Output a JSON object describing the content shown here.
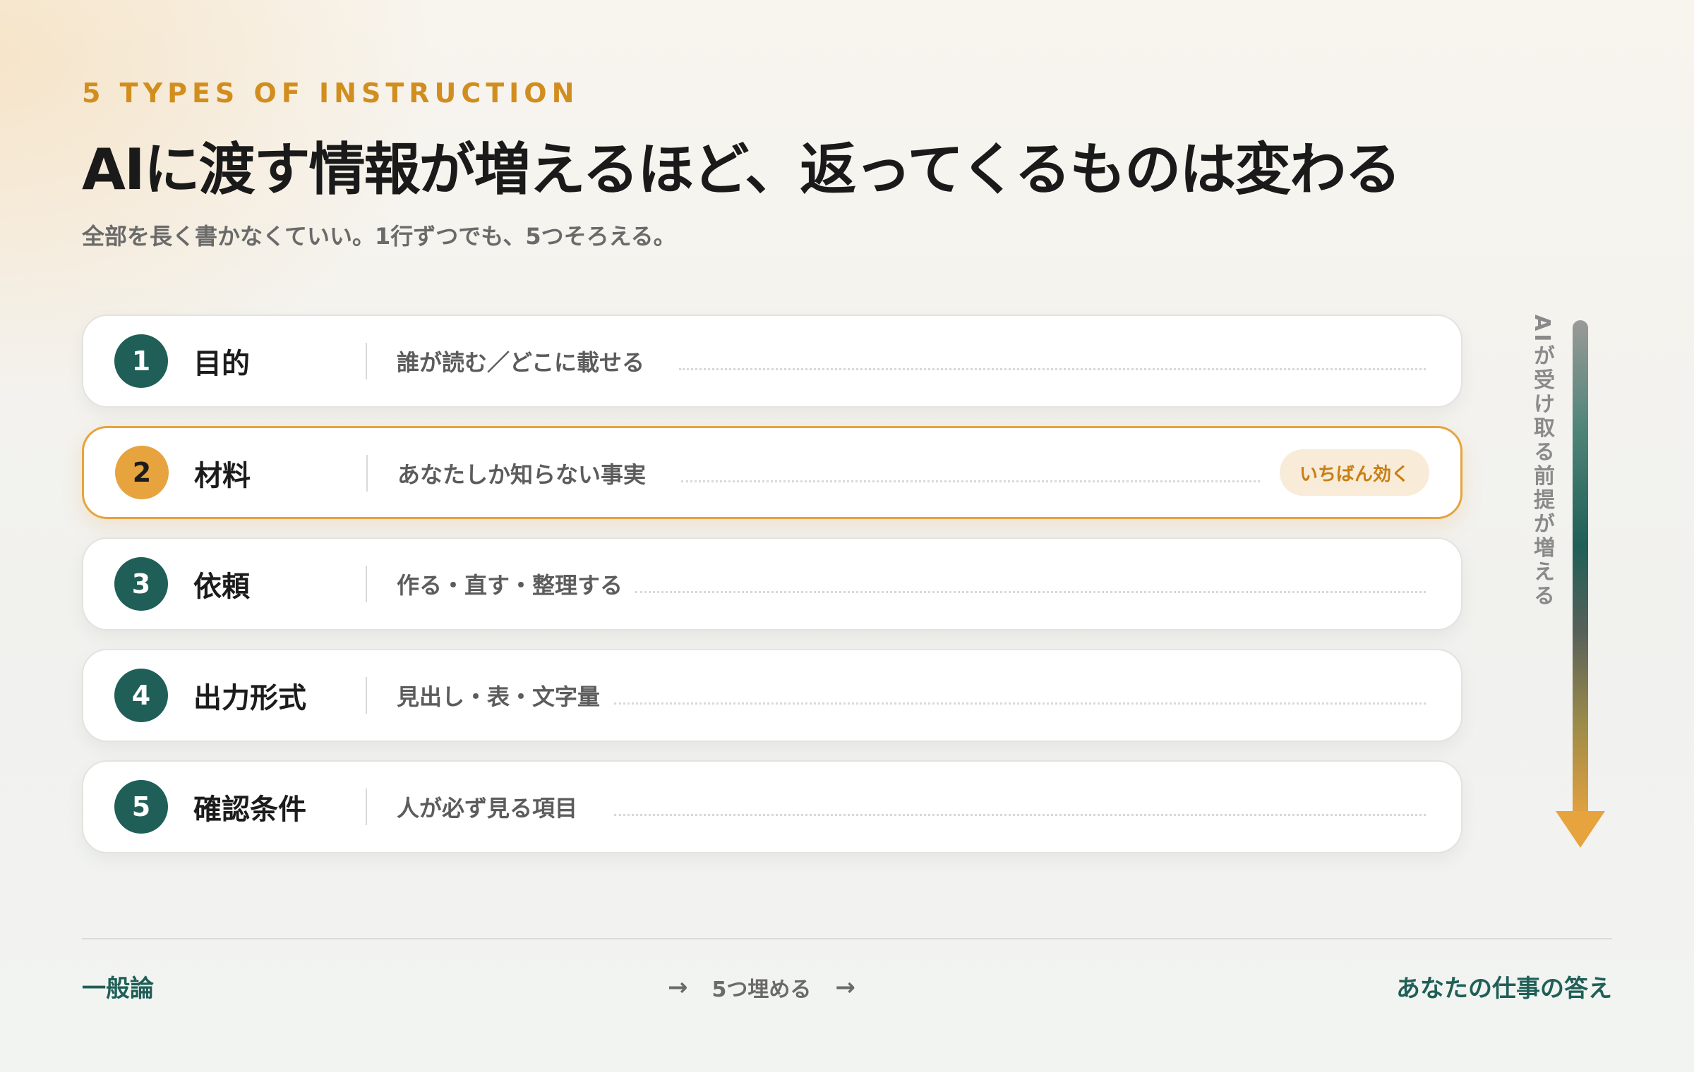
{
  "header": {
    "eyebrow": "5 TYPES OF INSTRUCTION",
    "title": "AIに渡す情報が増えるほど、返ってくるものは変わる",
    "subtitle": "全部を長く書かなくていい。1行ずつでも、5つそろえる。"
  },
  "items": [
    {
      "number": "1",
      "label": "目的",
      "description": "誰が読む／どこに載せる"
    },
    {
      "number": "2",
      "label": "材料",
      "description": "あなたしか知らない事実",
      "badge": "いちばん効く",
      "highlight": true
    },
    {
      "number": "3",
      "label": "依頼",
      "description": "作る・直す・整理する"
    },
    {
      "number": "4",
      "label": "出力形式",
      "description": "見出し・表・文字量"
    },
    {
      "number": "5",
      "label": "確認条件",
      "description": "人が必ず見る項目"
    }
  ],
  "side": {
    "label": "AIが受け取る前提が増える",
    "icon": "down-arrow-icon"
  },
  "footer": {
    "left": "一般論",
    "middle_arrow_left": "→",
    "middle": "5つ埋める",
    "middle_arrow_right": "→",
    "right": "あなたの仕事の答え"
  },
  "colors": {
    "accent": "#e7a33e",
    "primary": "#1f5f57",
    "eyebrow": "#d18e1f"
  }
}
